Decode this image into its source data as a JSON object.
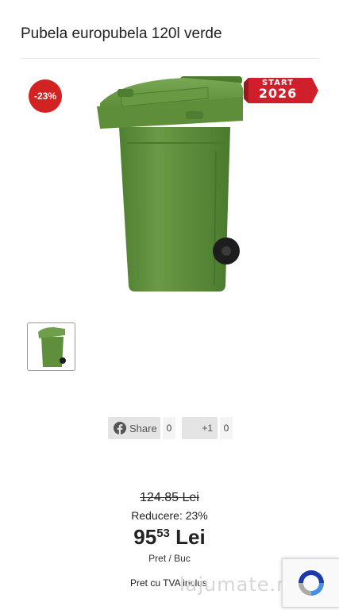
{
  "product": {
    "title": "Pubela europubela 120l verde",
    "discount_badge": "-23%",
    "ribbon": {
      "line1": "START",
      "line2": "2026"
    }
  },
  "social": {
    "share_label": "Share",
    "share_count": "0",
    "plus_label": "+1",
    "plus_count": "0"
  },
  "pricing": {
    "old_price": "124.85 Lei",
    "discount_text": "Reducere: 23%",
    "price_whole": "95",
    "price_cents": "53",
    "currency": "Lei",
    "unit": "Pret / Buc",
    "vat_note": "Pret cu TVA inclus"
  },
  "watermark": "lajumate.ro",
  "colors": {
    "badge": "#d32222",
    "bin_green": "#5f8f3d",
    "ribbon_red": "#cf1f2a"
  },
  "icons": [
    "facebook-icon",
    "recaptcha-icon"
  ]
}
